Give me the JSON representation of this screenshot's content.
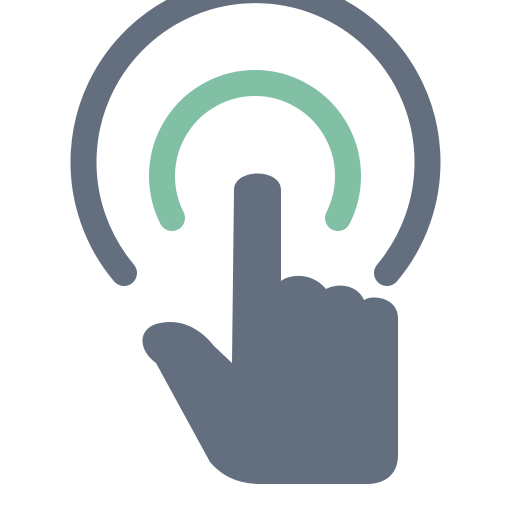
{
  "icon": {
    "name": "tap-gesture-icon",
    "colors": {
      "hand": "#636e7e",
      "outer_ring": "#636e7e",
      "inner_ring": "#82c0a6",
      "background": "#ffffff"
    }
  }
}
